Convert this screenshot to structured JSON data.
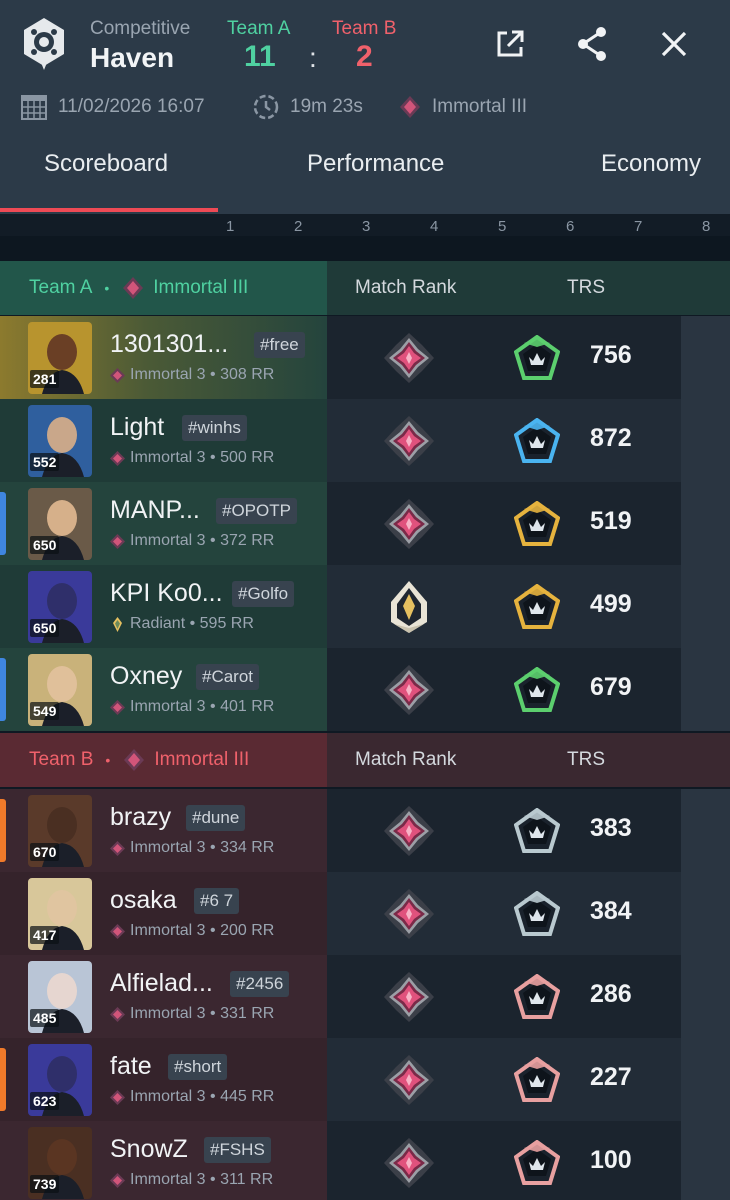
{
  "header": {
    "mode": "Competitive",
    "map": "Haven",
    "team_a_label": "Team A",
    "team_b_label": "Team B",
    "score_a": "11",
    "score_sep": ":",
    "score_b": "2",
    "date": "11/02/2026 16:07",
    "duration": "19m 23s",
    "avg_rank": "Immortal III",
    "colors": {
      "team_a": "#4fd1a1",
      "team_b": "#f0616b",
      "accent": "#ee4a55"
    }
  },
  "tabs": [
    {
      "label": "Scoreboard",
      "active": true
    },
    {
      "label": "Performance",
      "active": false
    },
    {
      "label": "Economy",
      "active": false
    }
  ],
  "round_numbers": [
    "1",
    "2",
    "3",
    "4",
    "5",
    "6",
    "7",
    "8"
  ],
  "team_a": {
    "label": "Team A",
    "dot": "•",
    "rank": "Immortal III",
    "col_match_rank": "Match Rank",
    "col_trs": "TRS",
    "players": [
      {
        "name": "1301301...",
        "tag": "#free",
        "acs": "281",
        "rank": "Immortal 3 • 308 RR",
        "trs": "756",
        "match_rank_icon": "immortal-icon",
        "trs_tier": "green"
      },
      {
        "name": "Light",
        "tag": "#winhs",
        "acs": "552",
        "rank": "Immortal 3 • 500 RR",
        "trs": "872",
        "match_rank_icon": "immortal-icon",
        "trs_tier": "blue"
      },
      {
        "name": "MANP...",
        "tag": "#OPOTP",
        "acs": "650",
        "rank": "Immortal 3 • 372 RR",
        "trs": "519",
        "match_rank_icon": "immortal-icon",
        "trs_tier": "gold"
      },
      {
        "name": "KPI Ko0...",
        "tag": "#Golfo",
        "acs": "650",
        "rank": "Radiant • 595 RR",
        "trs": "499",
        "match_rank_icon": "radiant-icon",
        "trs_tier": "gold"
      },
      {
        "name": "Oxney",
        "tag": "#Carot",
        "acs": "549",
        "rank": "Immortal 3 • 401 RR",
        "trs": "679",
        "match_rank_icon": "immortal-icon",
        "trs_tier": "green"
      }
    ]
  },
  "team_b": {
    "label": "Team B",
    "dot": "•",
    "rank": "Immortal III",
    "col_match_rank": "Match Rank",
    "col_trs": "TRS",
    "players": [
      {
        "name": "brazy",
        "tag": "#dune",
        "acs": "670",
        "rank": "Immortal 3 • 334 RR",
        "trs": "383",
        "match_rank_icon": "immortal-icon",
        "trs_tier": "silver"
      },
      {
        "name": "osaka",
        "tag": "#6 7",
        "acs": "417",
        "rank": "Immortal 3 • 200 RR",
        "trs": "384",
        "match_rank_icon": "immortal-icon",
        "trs_tier": "silver"
      },
      {
        "name": "Alfielad...",
        "tag": "#2456",
        "acs": "485",
        "rank": "Immortal 3 • 331 RR",
        "trs": "286",
        "match_rank_icon": "immortal-icon",
        "trs_tier": "red"
      },
      {
        "name": "fate",
        "tag": "#short",
        "acs": "623",
        "rank": "Immortal 3 • 445 RR",
        "trs": "227",
        "match_rank_icon": "immortal-icon",
        "trs_tier": "red"
      },
      {
        "name": "SnowZ",
        "tag": "#FSHS",
        "acs": "739",
        "rank": "Immortal 3 • 311 RR",
        "trs": "100",
        "match_rank_icon": "immortal-icon",
        "trs_tier": "red"
      }
    ]
  }
}
